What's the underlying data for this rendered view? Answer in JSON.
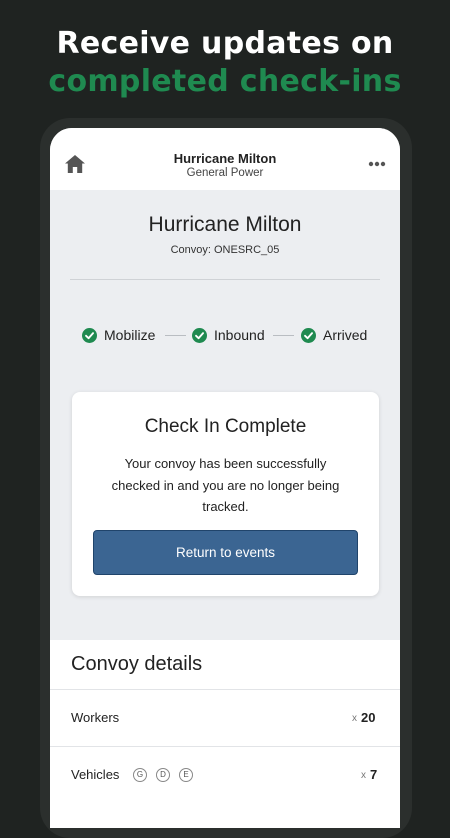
{
  "promo": {
    "line1": "Receive updates on",
    "line2": "completed check-ins",
    "accent_color": "#1f8a50"
  },
  "appbar": {
    "title": "Hurricane Milton",
    "subtitle": "General Power",
    "left_icon": "home-icon",
    "right_icon": "more-icon"
  },
  "event": {
    "title": "Hurricane Milton",
    "convoy_id": "Convoy: ONESRC_05"
  },
  "steps": [
    {
      "label": "Mobilize",
      "status": "complete"
    },
    {
      "label": "Inbound",
      "status": "complete"
    },
    {
      "label": "Arrived",
      "status": "complete"
    }
  ],
  "status_color": "#1f8a50",
  "card": {
    "title": "Check In Complete",
    "message": "Your convoy has been successfully checked in and you are no longer being tracked.",
    "button_label": "Return to events",
    "button_color": "#3b6592"
  },
  "details": {
    "title": "Convoy details",
    "rows": [
      {
        "label": "Workers",
        "multiplier": "x",
        "value": "20"
      },
      {
        "label": "Vehicles",
        "multiplier": "x",
        "value": "7",
        "badges": [
          "G",
          "D",
          "E"
        ]
      }
    ]
  }
}
